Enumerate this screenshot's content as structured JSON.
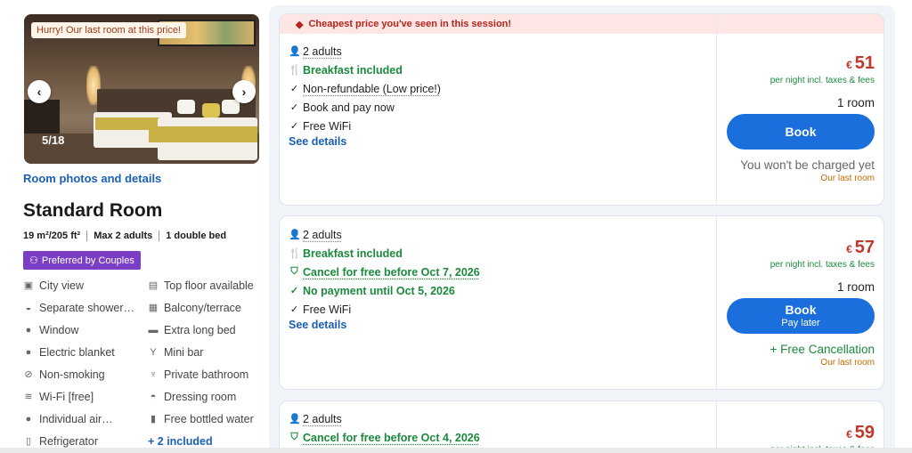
{
  "room": {
    "badge": "Hurry! Our last room at this price!",
    "photo_counter": "5/18",
    "photos_link": "Room photos and details",
    "title": "Standard Room",
    "specs": [
      "19 m²/205 ft²",
      "Max 2 adults",
      "1 double bed"
    ],
    "preferred_badge": "Preferred by Couples",
    "amenities": [
      {
        "label": "City view",
        "icon": "city-view-icon"
      },
      {
        "label": "Top floor available",
        "icon": "building-icon"
      },
      {
        "label": "Separate shower…",
        "icon": "shower-icon"
      },
      {
        "label": "Balcony/terrace",
        "icon": "balcony-icon"
      },
      {
        "label": "Window",
        "icon": "window-icon"
      },
      {
        "label": "Extra long bed",
        "icon": "bed-icon"
      },
      {
        "label": "Electric blanket",
        "icon": "blanket-icon"
      },
      {
        "label": "Mini bar",
        "icon": "minibar-icon"
      },
      {
        "label": "Non-smoking",
        "icon": "no-smoking-icon"
      },
      {
        "label": "Private bathroom",
        "icon": "bathroom-icon"
      },
      {
        "label": "Wi-Fi [free]",
        "icon": "wifi-icon"
      },
      {
        "label": "Dressing room",
        "icon": "dressing-room-icon"
      },
      {
        "label": "Individual air…",
        "icon": "air-conditioning-icon"
      },
      {
        "label": "Free bottled water",
        "icon": "water-bottle-icon"
      },
      {
        "label": "Refrigerator",
        "icon": "refrigerator-icon"
      }
    ],
    "more_included": "+ 2 included"
  },
  "offers": [
    {
      "banner": "Cheapest price you've seen in this session!",
      "occupancy": "2 adults",
      "features": [
        {
          "text": "Breakfast included",
          "style": "green",
          "icon": "fork-knife-icon"
        },
        {
          "text": "Non-refundable (Low price!)",
          "style": "plain-dotted",
          "icon": "check-icon"
        },
        {
          "text": "Book and pay now",
          "style": "plain",
          "icon": "check-icon"
        },
        {
          "text": "Free WiFi",
          "style": "plain",
          "icon": "check-icon"
        }
      ],
      "details_link": "See details",
      "currency": "€",
      "price": "51",
      "price_note": "per night incl. taxes & fees",
      "rooms": "1 room",
      "book_label": "Book",
      "book_sublabel": "",
      "bottom_note": "You won't be charged yet",
      "last_room": "Our last room"
    },
    {
      "banner": "",
      "occupancy": "2 adults",
      "features": [
        {
          "text": "Breakfast included",
          "style": "green",
          "icon": "fork-knife-icon"
        },
        {
          "text": "Cancel for free before Oct 7, 2026",
          "style": "green-underline",
          "icon": "shield-check-icon"
        },
        {
          "text": "No payment until Oct 5, 2026",
          "style": "green",
          "icon": "check-icon"
        },
        {
          "text": "Free WiFi",
          "style": "plain",
          "icon": "check-icon"
        }
      ],
      "details_link": "See details",
      "currency": "€",
      "price": "57",
      "price_note": "per night incl. taxes & fees",
      "rooms": "1 room",
      "book_label": "Book",
      "book_sublabel": "Pay later",
      "bottom_note": "+ Free Cancellation",
      "last_room": "Our last room"
    },
    {
      "banner": "",
      "occupancy": "2 adults",
      "features": [
        {
          "text": "Cancel for free before Oct 4, 2026",
          "style": "green-underline",
          "icon": "shield-check-icon"
        }
      ],
      "currency": "€",
      "price": "59",
      "price_note": "per night incl. taxes & fees"
    }
  ],
  "colors": {
    "accent": "#1a6fdc",
    "price": "#c0392b",
    "green": "#1b8a3c",
    "couples": "#7b3fc6"
  }
}
